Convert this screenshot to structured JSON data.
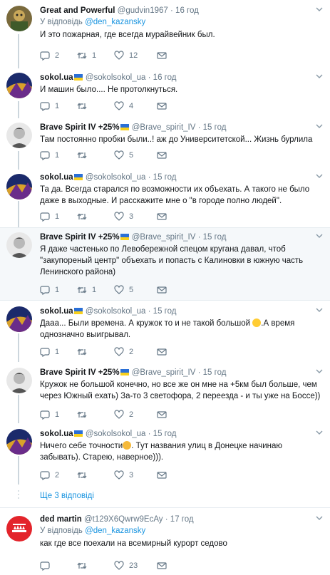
{
  "reply_prefix": "У відповідь",
  "show_more_replies": "Ще 3 відповіді",
  "tweets": [
    {
      "name": "Great and Powerful",
      "handle": "@gudvin1967",
      "time": "16 год",
      "reply_to": "@den_kazansky",
      "text": "И это пожарная, где всегда мурайвейник был.",
      "replies": "2",
      "retweets": "1",
      "likes": "12"
    },
    {
      "name": "sokol.ua",
      "handle": "@sokolsokol_ua",
      "time": "16 год",
      "text": "И машин было.... Не протолкнуться.",
      "replies": "1",
      "retweets": "",
      "likes": "4"
    },
    {
      "name": "Brave Spirit IV +25%",
      "handle": "@Brave_spirit_IV",
      "time": "15 год",
      "text": "Там постоянно пробки были..! аж до Университетской... Жизнь бурлила",
      "replies": "1",
      "retweets": "",
      "likes": "5"
    },
    {
      "name": "sokol.ua",
      "handle": "@sokolsokol_ua",
      "time": "15 год",
      "text": "Та да.  Всегда старался по возможности их объехать. А такого не было даже в выходные. И расскажите мне о \"в городе полно людей\".",
      "replies": "1",
      "retweets": "",
      "likes": "3"
    },
    {
      "name": "Brave Spirit IV +25%",
      "handle": "@Brave_spirit_IV",
      "time": "15 год",
      "text": "Я даже частенько по Левобережной спецом кругана давал, чтоб \"закупореный центр\" объехать и попасть с Калиновки в южную часть Ленинского района)",
      "replies": "1",
      "retweets": "1",
      "likes": "5"
    },
    {
      "name": "sokol.ua",
      "handle": "@sokolsokol_ua",
      "time": "15 год",
      "text_a": "Дааа... Были времена. А кружок то и не такой большой",
      "text_b": ".А время однозначно выигрывал.",
      "replies": "1",
      "retweets": "",
      "likes": "2"
    },
    {
      "name": "Brave Spirit IV +25%",
      "handle": "@Brave_spirit_IV",
      "time": "15 год",
      "text": "Кружок не большой конечно, но все же он мне на +5км был больше, чем через Южный ехать) За-то 3 светофора, 2 переезда - и ты уже на Боссе))",
      "replies": "1",
      "retweets": "",
      "likes": "2"
    },
    {
      "name": "sokol.ua",
      "handle": "@sokolsokol_ua",
      "time": "15 год",
      "text_a": "Ничего себе точности",
      "text_b": ". Тут названия улиц в Донецке начинаю забывать). Старею, наверное))).",
      "replies": "2",
      "retweets": "",
      "likes": "3"
    },
    {
      "name": "ded martin",
      "handle": "@t129X6Qwrw9EcAy",
      "time": "17 год",
      "reply_to": "@den_kazansky",
      "text": "как где все поехали на всемирный курорт седово",
      "replies": "",
      "retweets": "",
      "likes": "23"
    }
  ]
}
